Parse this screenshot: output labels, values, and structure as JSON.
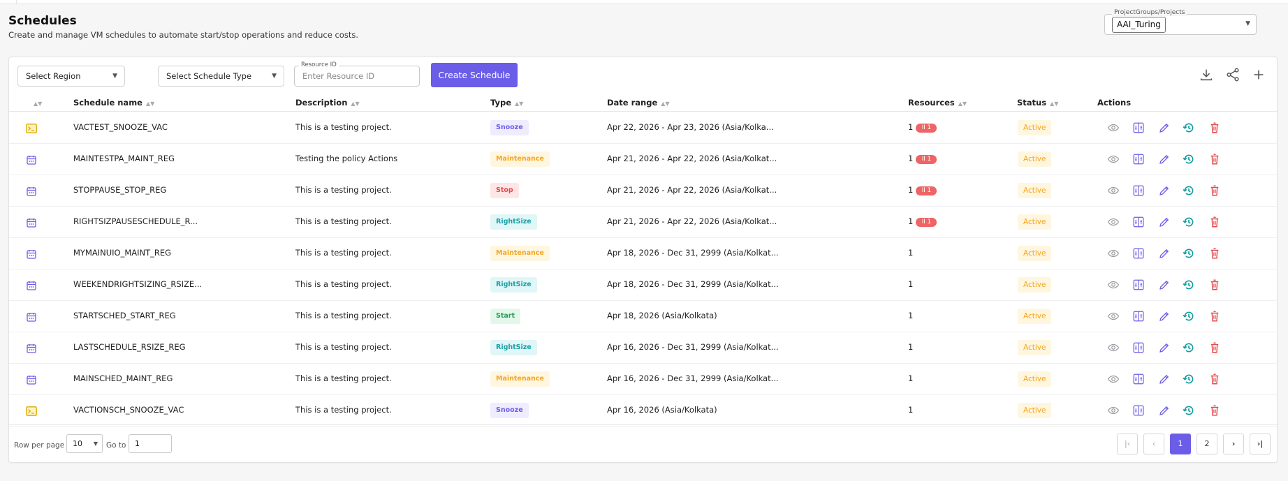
{
  "page": {
    "title": "Schedules",
    "subtitle": "Create and manage VM schedules to automate start/stop operations and reduce costs."
  },
  "project_selector": {
    "label": "ProjectGroups/Projects",
    "value": "AAI_Turing"
  },
  "filters": {
    "region_placeholder": "Select Region",
    "schedule_type_placeholder": "Select Schedule Type",
    "resource_id_label": "Resource ID",
    "resource_id_placeholder": "Enter Resource ID",
    "resource_id_value": "",
    "create_button": "Create Schedule"
  },
  "toolbar_icons": [
    "download-icon",
    "share-icon",
    "plus-icon"
  ],
  "table": {
    "columns": {
      "name": "Schedule name",
      "description": "Description",
      "type": "Type",
      "date_range": "Date range",
      "resources": "Resources",
      "status": "Status",
      "actions": "Actions"
    },
    "rows": [
      {
        "icon": "terminal-icon",
        "name": "VACTEST_SNOOZE_VAC",
        "description": "This is a testing project.",
        "type": "Snooze",
        "date_range": "Apr 22, 2026 - Apr 23, 2026 (Asia/Kolka...",
        "resources": "1",
        "resource_badge": "II 1",
        "status": "Active"
      },
      {
        "icon": "calendar-icon",
        "name": "MAINTESTPA_MAINT_REG",
        "description": "Testing the policy Actions",
        "type": "Maintenance",
        "date_range": "Apr 21, 2026 - Apr 22, 2026 (Asia/Kolkat...",
        "resources": "1",
        "resource_badge": "II 1",
        "status": "Active"
      },
      {
        "icon": "calendar-icon",
        "name": "STOPPAUSE_STOP_REG",
        "description": "This is a testing project.",
        "type": "Stop",
        "date_range": "Apr 21, 2026 - Apr 22, 2026 (Asia/Kolkat...",
        "resources": "1",
        "resource_badge": "II 1",
        "status": "Active"
      },
      {
        "icon": "calendar-icon",
        "name": "RIGHTSIZPAUSESCHEDULE_R...",
        "description": "This is a testing project.",
        "type": "RightSize",
        "date_range": "Apr 21, 2026 - Apr 22, 2026 (Asia/Kolkat...",
        "resources": "1",
        "resource_badge": "II 1",
        "status": "Active"
      },
      {
        "icon": "calendar-icon",
        "name": "MYMAINUIO_MAINT_REG",
        "description": "This is a testing project.",
        "type": "Maintenance",
        "date_range": "Apr 18, 2026 - Dec 31, 2999 (Asia/Kolkat...",
        "resources": "1",
        "resource_badge": "",
        "status": "Active"
      },
      {
        "icon": "calendar-icon",
        "name": "WEEKENDRIGHTSIZING_RSIZE...",
        "description": "This is a testing project.",
        "type": "RightSize",
        "date_range": "Apr 18, 2026 - Dec 31, 2999 (Asia/Kolkat...",
        "resources": "1",
        "resource_badge": "",
        "status": "Active"
      },
      {
        "icon": "calendar-icon",
        "name": "STARTSCHED_START_REG",
        "description": "This is a testing project.",
        "type": "Start",
        "date_range": "Apr 18, 2026 (Asia/Kolkata)",
        "resources": "1",
        "resource_badge": "",
        "status": "Active"
      },
      {
        "icon": "calendar-icon",
        "name": "LASTSCHEDULE_RSIZE_REG",
        "description": "This is a testing project.",
        "type": "RightSize",
        "date_range": "Apr 16, 2026 - Dec 31, 2999 (Asia/Kolkat...",
        "resources": "1",
        "resource_badge": "",
        "status": "Active"
      },
      {
        "icon": "calendar-icon",
        "name": "MAINSCHED_MAINT_REG",
        "description": "This is a testing project.",
        "type": "Maintenance",
        "date_range": "Apr 16, 2026 - Dec 31, 2999 (Asia/Kolkat...",
        "resources": "1",
        "resource_badge": "",
        "status": "Active"
      },
      {
        "icon": "terminal-icon",
        "name": "VACTIONSCH_SNOOZE_VAC",
        "description": "This is a testing project.",
        "type": "Snooze",
        "date_range": "Apr 16, 2026 (Asia/Kolkata)",
        "resources": "1",
        "resource_badge": "",
        "status": "Active"
      }
    ],
    "row_actions": [
      "view-icon",
      "compare-icon",
      "edit-icon",
      "history-icon",
      "delete-icon"
    ]
  },
  "pagination": {
    "rows_per_page_label": "Row per page",
    "rows_per_page_value": "10",
    "goto_label": "Go to",
    "goto_value": "1",
    "pages": [
      "1",
      "2"
    ],
    "current_page": "1"
  },
  "colors": {
    "accent": "#6b5de8",
    "active_status_bg": "#fff6df",
    "active_status_text": "#f5a524",
    "resource_badge": "#ef6464"
  }
}
